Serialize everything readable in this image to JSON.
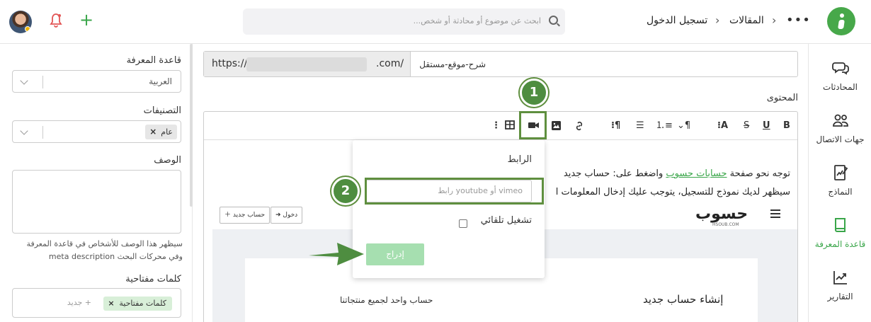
{
  "header": {
    "breadcrumb": [
      "المقالات",
      "تسجيل الدخول"
    ],
    "more": "•••",
    "search_placeholder": "ابحث عن موضوع أو محادثة أو شخص...",
    "brand_color": "#47a84a"
  },
  "nav": {
    "items": [
      {
        "label": "المحادثات",
        "icon": "chat-icon"
      },
      {
        "label": "جهات الاتصال",
        "icon": "contacts-icon"
      },
      {
        "label": "النماذج",
        "icon": "forms-icon"
      },
      {
        "label": "قاعدة المعرفة",
        "icon": "book-icon",
        "active": true
      },
      {
        "label": "التقارير",
        "icon": "chart-icon"
      }
    ]
  },
  "sidebar": {
    "kb_label": "قاعدة المعرفة",
    "kb_value": "العربية",
    "cat_label": "التصنيفات",
    "cat_tag": "عام",
    "desc_label": "الوصف",
    "desc_help": "سيظهر هذا الوصف للأشخاص في قاعدة المعرفة وفي محركات البحث meta description",
    "kw_label": "كلمات مفتاحية",
    "kw_tag": "كلمات مفتاحية",
    "kw_new": "+ جديد"
  },
  "main": {
    "url_prefix": "https://",
    "url_suffix": ".com/",
    "slug": "شرح-موقع-مستقل",
    "content_label": "المحتوى",
    "line1_a": "توجه نحو صفحة ",
    "line1_link": "حسابات حسوب",
    "line1_b": " واضغط على: حساب جديد",
    "line2": "سيظهر لديك نموذج للتسجيل، يتوجب عليك إدخال المعلومات ا",
    "shot": {
      "brand": "حسوب",
      "brand_sub": "HSOUB.COM",
      "login": "دخول",
      "new_account": "حساب جديد",
      "heading": "إنشاء حساب جديد",
      "sub": "حساب واحد لجميع منتجاتنا"
    }
  },
  "popup": {
    "label": "الرابط",
    "placeholder": "رابط youtube أو vimeo",
    "autoplay": "تشغيل تلقائي",
    "insert": "إدراج"
  },
  "annotations": {
    "step1": "1",
    "step2": "2",
    "color": "#4e8d40"
  }
}
